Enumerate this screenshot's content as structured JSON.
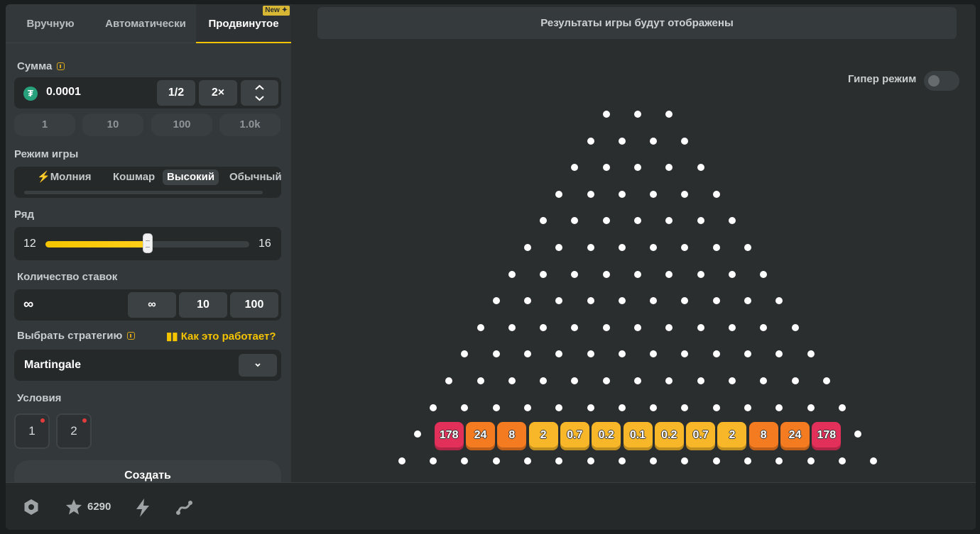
{
  "tabs": {
    "manual": "Вручную",
    "auto": "Автоматически",
    "advanced": "Продвинутое",
    "new_badge": "New"
  },
  "amount": {
    "label": "Сумма",
    "value": "0.0001",
    "currency_icon": "tether-icon",
    "half": "1/2",
    "double": "2×",
    "quick": [
      "1",
      "10",
      "100",
      "1.0k"
    ]
  },
  "game_mode": {
    "label": "Режим игры",
    "options": [
      "Молния",
      "Кошмар",
      "Высокий",
      "Обычный"
    ],
    "selected": "Высокий"
  },
  "rows": {
    "label": "Ряд",
    "min": "12",
    "max": "16",
    "current": 14,
    "fill_fraction": 0.5
  },
  "bet_count": {
    "label": "Количество ставок",
    "value": "∞",
    "options": [
      "∞",
      "10",
      "100"
    ]
  },
  "strategy": {
    "label": "Выбрать стратегию",
    "how_it_works": "Как это работает?",
    "selected": "Martingale"
  },
  "conditions": {
    "label": "Условия",
    "items": [
      "1",
      "2"
    ]
  },
  "create_label": "Создать",
  "results_text": "Результаты игры будут отображены",
  "hyper_mode_label": "Гипер режим",
  "hyper_mode_on": false,
  "multipliers": [
    "178",
    "24",
    "8",
    "2",
    "0.7",
    "0.2",
    "0.1",
    "0.2",
    "0.7",
    "2",
    "8",
    "24",
    "178"
  ],
  "footer": {
    "score": "6290"
  },
  "colors": {
    "accent": "#f5c400",
    "red": "#e3305a",
    "orange": "#f47b20",
    "yellow": "#f7b728"
  }
}
